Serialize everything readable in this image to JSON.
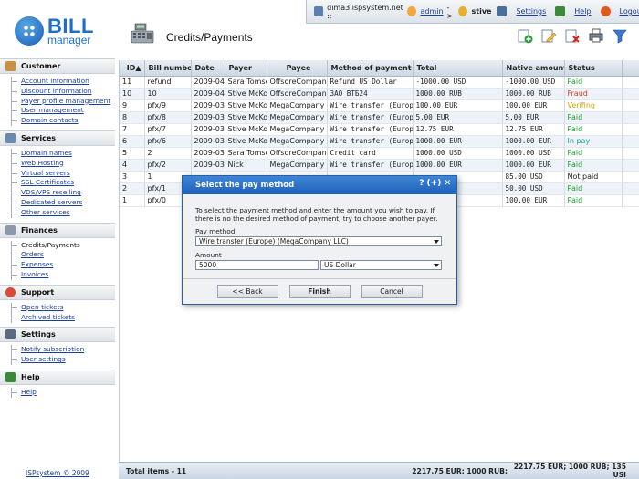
{
  "topbar": {
    "server": "dima3.ispsystem.net ::",
    "user_admin": "admin",
    "arrow": "->",
    "user_client": "stive",
    "settings": "Settings",
    "help": "Help",
    "logout": "Logout"
  },
  "logo": {
    "bill": "BILL",
    "manager": "manager"
  },
  "page_title": "Credits/Payments",
  "sidebar": {
    "customer": {
      "title": "Customer",
      "items": [
        "Account information",
        "Discount information",
        "Payer profile management",
        "User management",
        "Domain contacts"
      ]
    },
    "services": {
      "title": "Services",
      "items": [
        "Domain names",
        "Web Hosting",
        "Virtual servers",
        "SSL Certificates",
        "VDS/VPS reselling",
        "Dedicated servers",
        "Other services"
      ]
    },
    "finances": {
      "title": "Finances",
      "items": [
        "Credits/Payments",
        "Orders",
        "Expenses",
        "Invoices"
      ]
    },
    "support": {
      "title": "Support",
      "items": [
        "Open tickets",
        "Archived tickets"
      ]
    },
    "settings": {
      "title": "Settings",
      "items": [
        "Notify subscription",
        "User settings"
      ]
    },
    "help": {
      "title": "Help",
      "items": [
        "Help"
      ]
    },
    "footer": "ISPsystem © 2009"
  },
  "grid": {
    "headers": [
      "ID▲",
      "Bill numbe",
      "Date",
      "Payer",
      "Payee",
      "Method of payment (",
      "Total",
      "Native amount",
      "Status"
    ],
    "rows": [
      [
        "11",
        "refund",
        "2009-04",
        "Sara Tomso",
        "OffsoreCompan",
        "Refund US Dollar",
        "-1000.00 USD",
        "-1000.00 USD",
        "Paid",
        "paid"
      ],
      [
        "10",
        "10",
        "2009-04",
        "Stive McKor",
        "OffsoreCompan",
        "ЗАО ВТБ24",
        "1000.00 RUB",
        "1000.00 RUB",
        "Fraud",
        "fraud"
      ],
      [
        "9",
        "pfx/9",
        "2009-03",
        "Stive McKor",
        "MegaCompany I",
        "Wire transfer (Europe)",
        "100.00 EUR",
        "100.00 EUR",
        "Verifing",
        "verifying"
      ],
      [
        "8",
        "pfx/8",
        "2009-03",
        "Stive McKor",
        "MegaCompany I",
        "Wire transfer (Europe)",
        "5.00 EUR",
        "5.00 EUR",
        "Paid",
        "paid"
      ],
      [
        "7",
        "pfx/7",
        "2009-03",
        "Stive McKor",
        "MegaCompany I",
        "Wire transfer (Europe)",
        "12.75 EUR",
        "12.75 EUR",
        "Paid",
        "paid"
      ],
      [
        "6",
        "pfx/6",
        "2009-03",
        "Stive McKor",
        "MegaCompany I",
        "Wire transfer (Europe)",
        "1000.00 EUR",
        "1000.00 EUR",
        "In pay",
        "inpay"
      ],
      [
        "5",
        "2",
        "2009-03",
        "Sara Tomso",
        "OffsoreCompan",
        "Credit card",
        "1000.00 USD",
        "1000.00 USD",
        "Paid",
        "paid"
      ],
      [
        "4",
        "pfx/2",
        "2009-03",
        "Nick",
        "MegaCompany I",
        "Wire transfer (Europe)",
        "1000.00 EUR",
        "1000.00 EUR",
        "Paid",
        "paid"
      ],
      [
        "3",
        "1",
        "",
        "",
        "",
        "",
        "",
        "85.00 USD",
        "Not paid",
        "notpaid"
      ],
      [
        "2",
        "pfx/1",
        "",
        "",
        "",
        "",
        "",
        "50.00 USD",
        "Paid",
        "paid"
      ],
      [
        "1",
        "pfx/0",
        "",
        "",
        "",
        "",
        "",
        "100.00 EUR",
        "Paid",
        "paid"
      ]
    ]
  },
  "statusbar": {
    "total_items": "Total items - 11",
    "sum_total": "2217.75 EUR; 1000 RUB;",
    "sum_native": "2217.75 EUR; 1000 RUB; 135 USI"
  },
  "dialog": {
    "title": "Select the pay method",
    "controls": "? (+) ✕",
    "description": "To select the payment method and enter the amount you wish to pay. If there is no the desired method of payment, try to choose another payer.",
    "pay_method_label": "Pay method",
    "pay_method_value": "Wire transfer (Europe) (MegaCompany LLC)",
    "amount_label": "Amount",
    "amount_value": "5000",
    "currency_value": "US Dollar",
    "back_label": "<< Back",
    "finish_label": "Finish",
    "cancel_label": "Cancel"
  }
}
